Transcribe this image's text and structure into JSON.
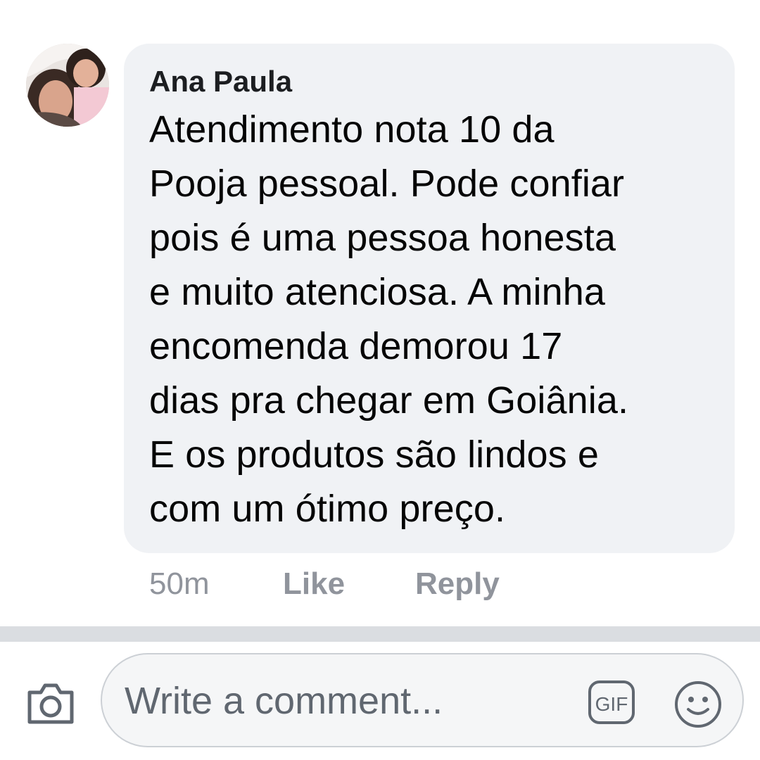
{
  "comment": {
    "author": "Ana Paula",
    "text": "Atendimento  nota 10 da\nPooja pessoal. Pode confiar\npois é uma pessoa honesta\ne muito atenciosa. A minha\nencomenda demorou 17\ndias pra chegar em Goiânia.\nE os produtos são lindos e\ncom um ótimo preço.",
    "time": "50m",
    "like_label": "Like",
    "reply_label": "Reply"
  },
  "composer": {
    "placeholder": "Write a comment...",
    "gif_label": "GIF",
    "camera_icon": "camera-icon",
    "emoji_icon": "smiley-icon"
  },
  "colors": {
    "bubble_bg": "#f0f2f5",
    "meta_text": "#90949c",
    "divider": "#dadde1",
    "icon": "#606770"
  }
}
